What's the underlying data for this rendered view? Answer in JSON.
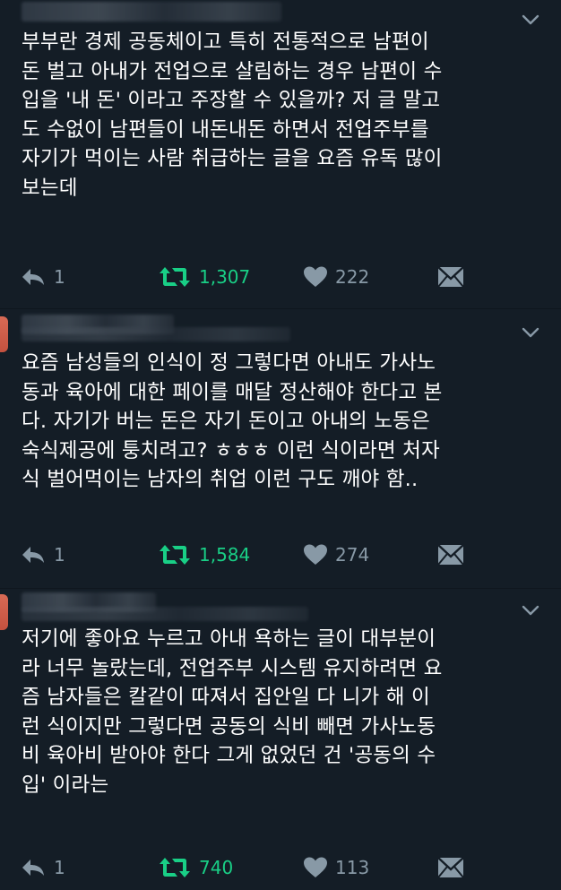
{
  "colors": {
    "background": "#141d26",
    "text": "#ffffff",
    "muted": "#8899a6",
    "retweet_active": "#19cf86"
  },
  "tweets": [
    {
      "text": "부부란 경제 공동체이고 특히 전통적으로 남편이\n돈 벌고 아내가 전업으로 살림하는 경우 남편이 수\n입을 '내 돈' 이라고 주장할 수 있을까? 저 글 말고\n도 수없이 남편들이 내돈내돈 하면서 전업주부를\n자기가 먹이는 사람 취급하는 글을 요즘 유독 많이\n보는데",
      "replies": "1",
      "retweets": "1,307",
      "likes": "222"
    },
    {
      "text": "요즘 남성들의 인식이 정 그렇다면 아내도 가사노\n동과 육아에 대한 페이를 매달 정산해야 한다고 본\n다. 자기가 버는 돈은 자기 돈이고 아내의 노동은\n숙식제공에 퉁치려고? ㅎㅎㅎ 이런 식이라면 처자\n식 벌어먹이는 남자의 취업 이런 구도 깨야 함..",
      "replies": "1",
      "retweets": "1,584",
      "likes": "274"
    },
    {
      "text": "저기에 좋아요 누르고 아내 욕하는 글이 대부분이\n라 너무 놀랐는데, 전업주부 시스템 유지하려면 요\n즘 남자들은 칼같이 따져서 집안일 다 니가 해 이\n런 식이지만 그렇다면 공동의 식비 빼면 가사노동\n비 육아비 받아야 한다 그게 없었던 건 '공동의 수\n입' 이라는",
      "replies": "1",
      "retweets": "740",
      "likes": "113"
    }
  ]
}
